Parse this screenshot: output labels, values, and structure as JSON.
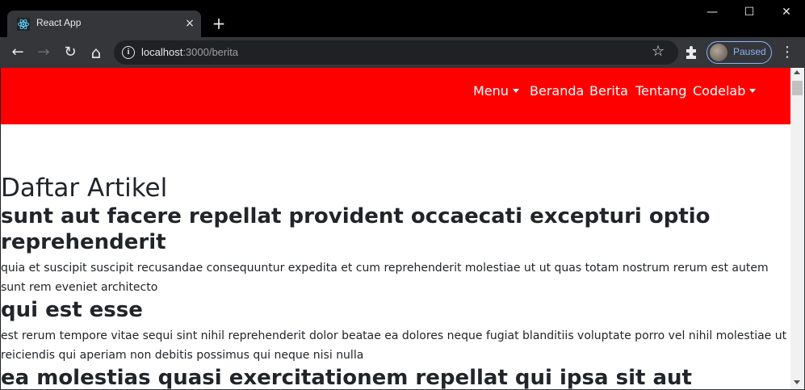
{
  "browser": {
    "tab_title": "React App",
    "tab_close_icon": "×",
    "new_tab_icon": "+",
    "window_controls": {
      "minimize": "—",
      "maximize": "☐",
      "close": "✕"
    },
    "nav": {
      "back": "←",
      "forward": "→",
      "reload": "↻",
      "home": "⌂"
    },
    "url_host": "localhost",
    "url_rest": ":3000/berita",
    "bookmark_icon": "☆",
    "profile_status": "Paused",
    "menu_icon": "⋮"
  },
  "page": {
    "navbar": {
      "color": "#ff0000",
      "items": [
        {
          "label": "Menu",
          "dropdown": true
        },
        {
          "label": "Beranda",
          "dropdown": false
        },
        {
          "label": "Berita",
          "dropdown": false
        },
        {
          "label": "Tentang",
          "dropdown": false
        },
        {
          "label": "Codelab",
          "dropdown": true
        }
      ]
    },
    "heading": "Daftar Artikel",
    "articles": [
      {
        "title": "sunt aut facere repellat provident occaecati excepturi optio reprehenderit",
        "body": "quia et suscipit suscipit recusandae consequuntur expedita et cum reprehenderit molestiae ut ut quas totam nostrum rerum est autem sunt rem eveniet architecto"
      },
      {
        "title": "qui est esse",
        "body": "est rerum tempore vitae sequi sint nihil reprehenderit dolor beatae ea dolores neque fugiat blanditiis voluptate porro vel nihil molestiae ut reiciendis qui aperiam non debitis possimus qui neque nisi nulla"
      },
      {
        "title": "ea molestias quasi exercitationem repellat qui ipsa sit aut",
        "body": ""
      }
    ]
  }
}
